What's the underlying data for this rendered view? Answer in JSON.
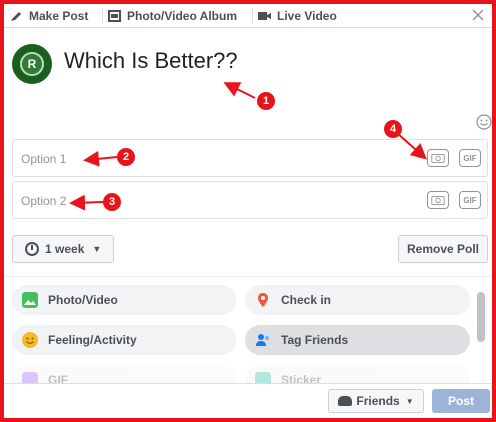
{
  "tabs": {
    "make_post": "Make Post",
    "album": "Photo/Video Album",
    "live": "Live Video"
  },
  "composer": {
    "question": "Which Is Better??",
    "avatar_letter": "R"
  },
  "options": [
    {
      "placeholder": "Option 1",
      "gif": "GIF"
    },
    {
      "placeholder": "Option 2",
      "gif": "GIF"
    }
  ],
  "duration": {
    "label": "1 week",
    "caret": "▼"
  },
  "remove_label": "Remove Poll",
  "actions": {
    "photo": "Photo/Video",
    "checkin": "Check in",
    "feeling": "Feeling/Activity",
    "tag": "Tag Friends",
    "gif": "GIF",
    "sticker": "Sticker"
  },
  "footer": {
    "audience": "Friends",
    "caret": "▼",
    "post": "Post"
  },
  "annotations": [
    "1",
    "2",
    "3",
    "4"
  ],
  "colors": {
    "accent": "#e8141b",
    "post_disabled": "#9cb4d8"
  },
  "icons": [
    "make-post-icon",
    "album-icon",
    "live-video-icon",
    "close-icon",
    "emoji-icon",
    "camera-icon",
    "gif-icon",
    "clock-icon",
    "photo-icon",
    "checkin-pin-icon",
    "feeling-icon",
    "tag-friends-icon",
    "friends-icon"
  ]
}
